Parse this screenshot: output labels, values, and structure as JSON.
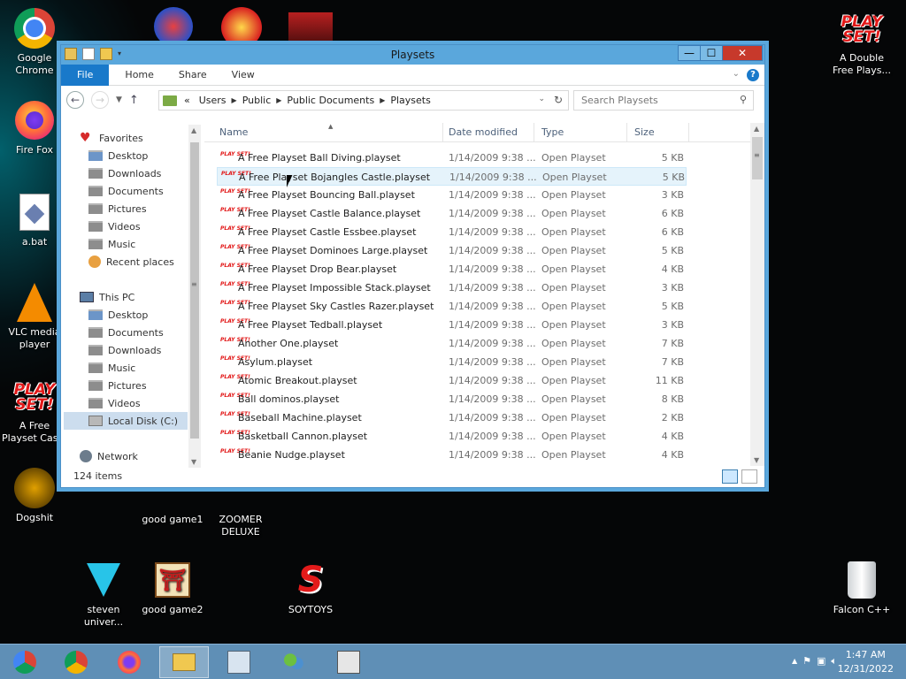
{
  "desktop": {
    "icons": [
      {
        "label": "Google Chrome"
      },
      {
        "label": "Fire Fox"
      },
      {
        "label": "a.bat"
      },
      {
        "label": "VLC media player"
      },
      {
        "label": "A Free Playset Cas..."
      },
      {
        "label": "Dogshit"
      },
      {
        "label": "good game1"
      },
      {
        "label": "ZOOMER DELUXE"
      },
      {
        "label": "steven univer..."
      },
      {
        "label": "good game2"
      },
      {
        "label": "SOYTOYS"
      },
      {
        "label": "A Double Free Plays..."
      },
      {
        "label": "Falcon C++"
      }
    ],
    "playset_glyph": "PLAY SET!"
  },
  "window": {
    "title": "Playsets",
    "ribbon_tabs": [
      "File",
      "Home",
      "Share",
      "View"
    ],
    "help": "?",
    "address": {
      "prefix": "«",
      "crumbs": [
        "Users",
        "Public",
        "Public Documents",
        "Playsets"
      ]
    },
    "search_placeholder": "Search Playsets",
    "nav": {
      "favorites": "Favorites",
      "fav_items": [
        "Desktop",
        "Downloads",
        "Documents",
        "Pictures",
        "Videos",
        "Music",
        "Recent places"
      ],
      "this_pc": "This PC",
      "pc_items": [
        "Desktop",
        "Documents",
        "Downloads",
        "Music",
        "Pictures",
        "Videos",
        "Local Disk (C:)"
      ],
      "network": "Network"
    },
    "columns": [
      "Name",
      "Date modified",
      "Type",
      "Size"
    ],
    "files": [
      {
        "name": "A Free Playset Ball Diving.playset",
        "date": "1/14/2009 9:38 ...",
        "type": "Open Playset",
        "size": "5 KB"
      },
      {
        "name": "A Free Playset Bojangles Castle.playset",
        "date": "1/14/2009 9:38 ...",
        "type": "Open Playset",
        "size": "5 KB"
      },
      {
        "name": "A Free Playset Bouncing Ball.playset",
        "date": "1/14/2009 9:38 ...",
        "type": "Open Playset",
        "size": "3 KB"
      },
      {
        "name": "A Free Playset Castle Balance.playset",
        "date": "1/14/2009 9:38 ...",
        "type": "Open Playset",
        "size": "6 KB"
      },
      {
        "name": "A Free Playset Castle Essbee.playset",
        "date": "1/14/2009 9:38 ...",
        "type": "Open Playset",
        "size": "6 KB"
      },
      {
        "name": "A Free Playset Dominoes Large.playset",
        "date": "1/14/2009 9:38 ...",
        "type": "Open Playset",
        "size": "5 KB"
      },
      {
        "name": "A Free Playset Drop Bear.playset",
        "date": "1/14/2009 9:38 ...",
        "type": "Open Playset",
        "size": "4 KB"
      },
      {
        "name": "A Free Playset Impossible Stack.playset",
        "date": "1/14/2009 9:38 ...",
        "type": "Open Playset",
        "size": "3 KB"
      },
      {
        "name": "A Free Playset Sky Castles Razer.playset",
        "date": "1/14/2009 9:38 ...",
        "type": "Open Playset",
        "size": "5 KB"
      },
      {
        "name": "A Free Playset Tedball.playset",
        "date": "1/14/2009 9:38 ...",
        "type": "Open Playset",
        "size": "3 KB"
      },
      {
        "name": "Another One.playset",
        "date": "1/14/2009 9:38 ...",
        "type": "Open Playset",
        "size": "7 KB"
      },
      {
        "name": "Asylum.playset",
        "date": "1/14/2009 9:38 ...",
        "type": "Open Playset",
        "size": "7 KB"
      },
      {
        "name": "Atomic Breakout.playset",
        "date": "1/14/2009 9:38 ...",
        "type": "Open Playset",
        "size": "11 KB"
      },
      {
        "name": "Ball dominos.playset",
        "date": "1/14/2009 9:38 ...",
        "type": "Open Playset",
        "size": "8 KB"
      },
      {
        "name": "Baseball Machine.playset",
        "date": "1/14/2009 9:38 ...",
        "type": "Open Playset",
        "size": "2 KB"
      },
      {
        "name": "Basketball Cannon.playset",
        "date": "1/14/2009 9:38 ...",
        "type": "Open Playset",
        "size": "4 KB"
      },
      {
        "name": "Beanie Nudge.playset",
        "date": "1/14/2009 9:38 ...",
        "type": "Open Playset",
        "size": "4 KB"
      }
    ],
    "status": "124 items"
  },
  "taskbar": {
    "clock_time": "1:47 AM",
    "clock_date": "12/31/2022",
    "tray_chevron": "▲"
  }
}
